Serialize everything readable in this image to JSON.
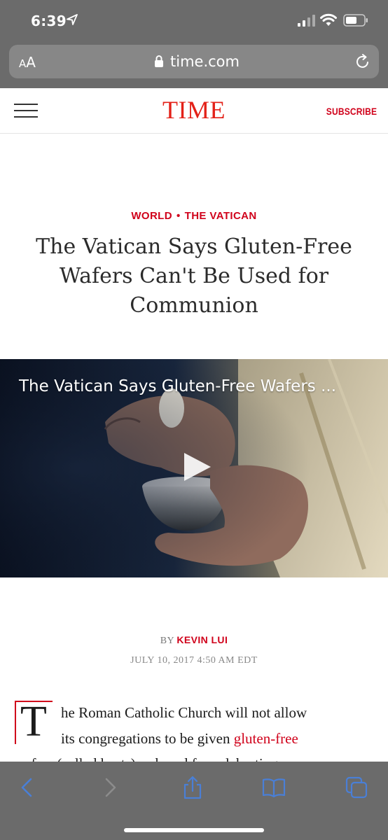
{
  "status_bar": {
    "time": "6:39",
    "icons": [
      "location-arrow-icon",
      "cellular-signal-icon",
      "wifi-icon",
      "battery-icon"
    ]
  },
  "safari": {
    "text_size_button_small": "A",
    "text_size_button_large": "A",
    "url": "time.com",
    "toolbar_icons": [
      "back-icon",
      "forward-icon",
      "share-icon",
      "bookmarks-icon",
      "tabs-icon"
    ]
  },
  "site_header": {
    "logo": "TIME",
    "subscribe": "SUBSCRIBE"
  },
  "article": {
    "section_primary": "WORLD",
    "section_separator": "•",
    "section_secondary": "THE VATICAN",
    "headline": "The Vatican Says Gluten-Free Wafers Can't Be Used for Communion",
    "video_title": "The Vatican Says Gluten-Free Wafers ...",
    "byline_prefix": "BY",
    "author": "KEVIN LUI",
    "date": "JULY 10, 2017 4:50 AM EDT",
    "drop_cap": "T",
    "body_line1": "he Roman Catholic Church will not allow",
    "body_line2_before_link": "its congregations to be given ",
    "body_link": "gluten-free",
    "body_line3": "wafers (called hosts) as bread for celebrating"
  },
  "colors": {
    "chrome_gray": "#6b6b6b",
    "url_bar_gray": "#878787",
    "time_red": "#e32118",
    "accent_red": "#d0021b",
    "ios_blue": "#4a7fd6"
  }
}
